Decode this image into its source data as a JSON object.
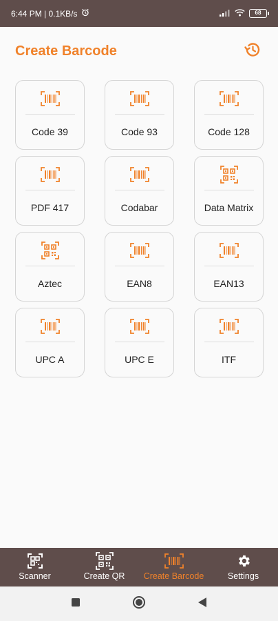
{
  "status_bar": {
    "time_speed": "6:44 PM | 0.1KB/s",
    "battery": "68"
  },
  "header": {
    "title": "Create Barcode"
  },
  "tiles": [
    {
      "label": "Code 39",
      "icon": "barcode-icon"
    },
    {
      "label": "Code 93",
      "icon": "barcode-icon"
    },
    {
      "label": "Code 128",
      "icon": "barcode-icon"
    },
    {
      "label": "PDF 417",
      "icon": "barcode-icon"
    },
    {
      "label": "Codabar",
      "icon": "barcode-icon"
    },
    {
      "label": "Data Matrix",
      "icon": "qr-icon"
    },
    {
      "label": "Aztec",
      "icon": "qr-icon"
    },
    {
      "label": "EAN8",
      "icon": "barcode-icon"
    },
    {
      "label": "EAN13",
      "icon": "barcode-icon"
    },
    {
      "label": "UPC A",
      "icon": "barcode-icon"
    },
    {
      "label": "UPC E",
      "icon": "barcode-icon"
    },
    {
      "label": "ITF",
      "icon": "barcode-icon"
    }
  ],
  "bottom_nav": {
    "items": [
      {
        "label": "Scanner",
        "icon": "scan-icon",
        "active": false
      },
      {
        "label": "Create QR",
        "icon": "qr-icon",
        "active": false
      },
      {
        "label": "Create Barcode",
        "icon": "barcode-icon",
        "active": true
      },
      {
        "label": "Settings",
        "icon": "gear-icon",
        "active": false
      }
    ]
  },
  "colors": {
    "accent": "#f0822b",
    "bar": "#5f4d4b",
    "background": "#fafafa"
  }
}
